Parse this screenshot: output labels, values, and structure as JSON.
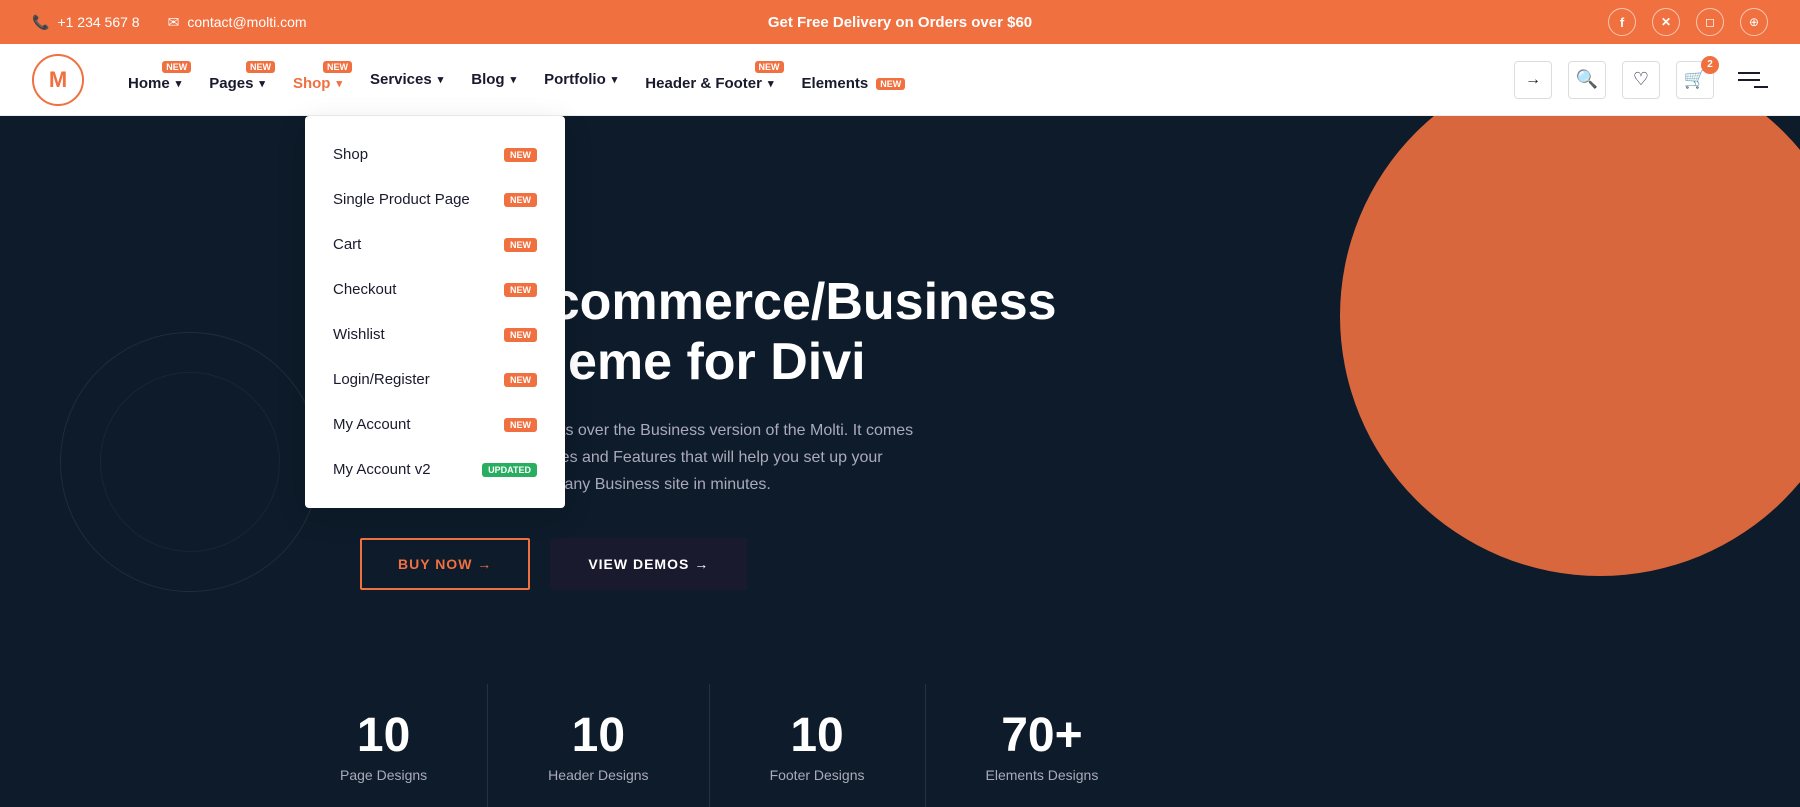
{
  "topbar": {
    "phone": "+1 234 567 8",
    "email": "contact@molti.com",
    "promo": "Get Free Delivery on Orders over $60",
    "social": [
      {
        "name": "facebook",
        "icon": "f"
      },
      {
        "name": "twitter-x",
        "icon": "𝕏"
      },
      {
        "name": "instagram",
        "icon": "◻"
      },
      {
        "name": "dribbble",
        "icon": "⊕"
      }
    ]
  },
  "nav": {
    "logo": "M",
    "items": [
      {
        "label": "Home",
        "badge": "NEW",
        "hasDropdown": true
      },
      {
        "label": "Pages",
        "badge": "NEW",
        "hasDropdown": true
      },
      {
        "label": "Shop",
        "badge": "NEW",
        "hasDropdown": true,
        "active": true
      },
      {
        "label": "Services",
        "badge": null,
        "hasDropdown": true
      },
      {
        "label": "Blog",
        "badge": null,
        "hasDropdown": true
      },
      {
        "label": "Portfolio",
        "badge": null,
        "hasDropdown": true
      },
      {
        "label": "Header & Footer",
        "badge": "NEW",
        "hasDropdown": true
      },
      {
        "label": "Elements",
        "badge": "NEW",
        "hasDropdown": false
      }
    ],
    "cartCount": "2"
  },
  "dropdown": {
    "items": [
      {
        "label": "Shop",
        "badge": "NEW",
        "badgeType": "new"
      },
      {
        "label": "Single Product Page",
        "badge": "NEW",
        "badgeType": "new"
      },
      {
        "label": "Cart",
        "badge": "NEW",
        "badgeType": "new"
      },
      {
        "label": "Checkout",
        "badge": "NEW",
        "badgeType": "new"
      },
      {
        "label": "Wishlist",
        "badge": "NEW",
        "badgeType": "new"
      },
      {
        "label": "Login/Register",
        "badge": "NEW",
        "badgeType": "new"
      },
      {
        "label": "My Account",
        "badge": "NEW",
        "badgeType": "new"
      },
      {
        "label": "My Account v2",
        "badge": "UPDATED",
        "badgeType": "updated"
      }
    ]
  },
  "hero": {
    "title_line1": "rpose Ecommerce/Business",
    "title_line2": "Child Theme for Divi",
    "description": "ce provides you more benefits over the Business version of the Molti. It comes\nWooCommerce Functionalities and Features that will help you set up your\nEcommerce store as well as any Business site in minutes.",
    "btn_buy": "BUY NOW →",
    "btn_demos": "VIEW DEMOS →",
    "stats": [
      {
        "number": "10",
        "label": "Page Designs"
      },
      {
        "number": "10",
        "label": "Header Designs"
      },
      {
        "number": "10",
        "label": "Footer Designs"
      },
      {
        "number": "70+",
        "label": "Elements Designs"
      }
    ]
  }
}
